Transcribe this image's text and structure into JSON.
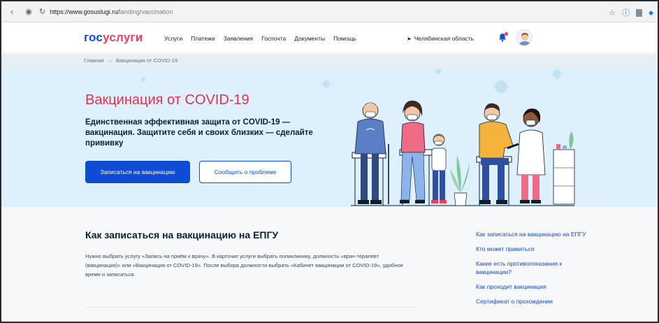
{
  "browser": {
    "url_protocol": "https://www.gosuslugi.ru/",
    "url_path": "landing/vaccination"
  },
  "header": {
    "logo_part1": "гос",
    "logo_part2": "услуги",
    "menu": [
      "Услуги",
      "Платежи",
      "Заявления",
      "Госпочта",
      "Документы",
      "Помощь"
    ],
    "region": "Челябинская область"
  },
  "breadcrumb": {
    "home": "Главная",
    "separator": "→",
    "current": "Вакцинация от COVID-19"
  },
  "hero": {
    "title": "Вакцинация от COVID-19",
    "text": "Единственная эффективная защита от COVID-19 — вакцинация. Защитите себя и своих близких — сделайте прививку",
    "primary_button": "Записаться на вакцинацию",
    "secondary_button": "Сообщить о проблеме"
  },
  "section": {
    "title": "Как записаться на вакцинацию на ЕПГУ",
    "text": "Нужно выбрать услугу «Запись на приём к врачу». В карточке услуги выбрать поликлинику, должность «врач-терапевт (вакцинация)» или «Вакцинация от COVID-19». После выбора должности выбрать «Кабинет вакцинации от COVID-19», удобное время и записаться."
  },
  "side_links": [
    "Как записаться на вакцинацию на ЕПГУ",
    "Кто может привиться",
    "Какие есть противопоказания к вакцинации?",
    "Как проходит вакцинация",
    "Сертификат о прохождении"
  ],
  "colors": {
    "brand_blue": "#0d4cd3",
    "brand_red": "#ee3f58",
    "hero_bg": "#ddf0fb",
    "title_red": "#e2324a"
  }
}
